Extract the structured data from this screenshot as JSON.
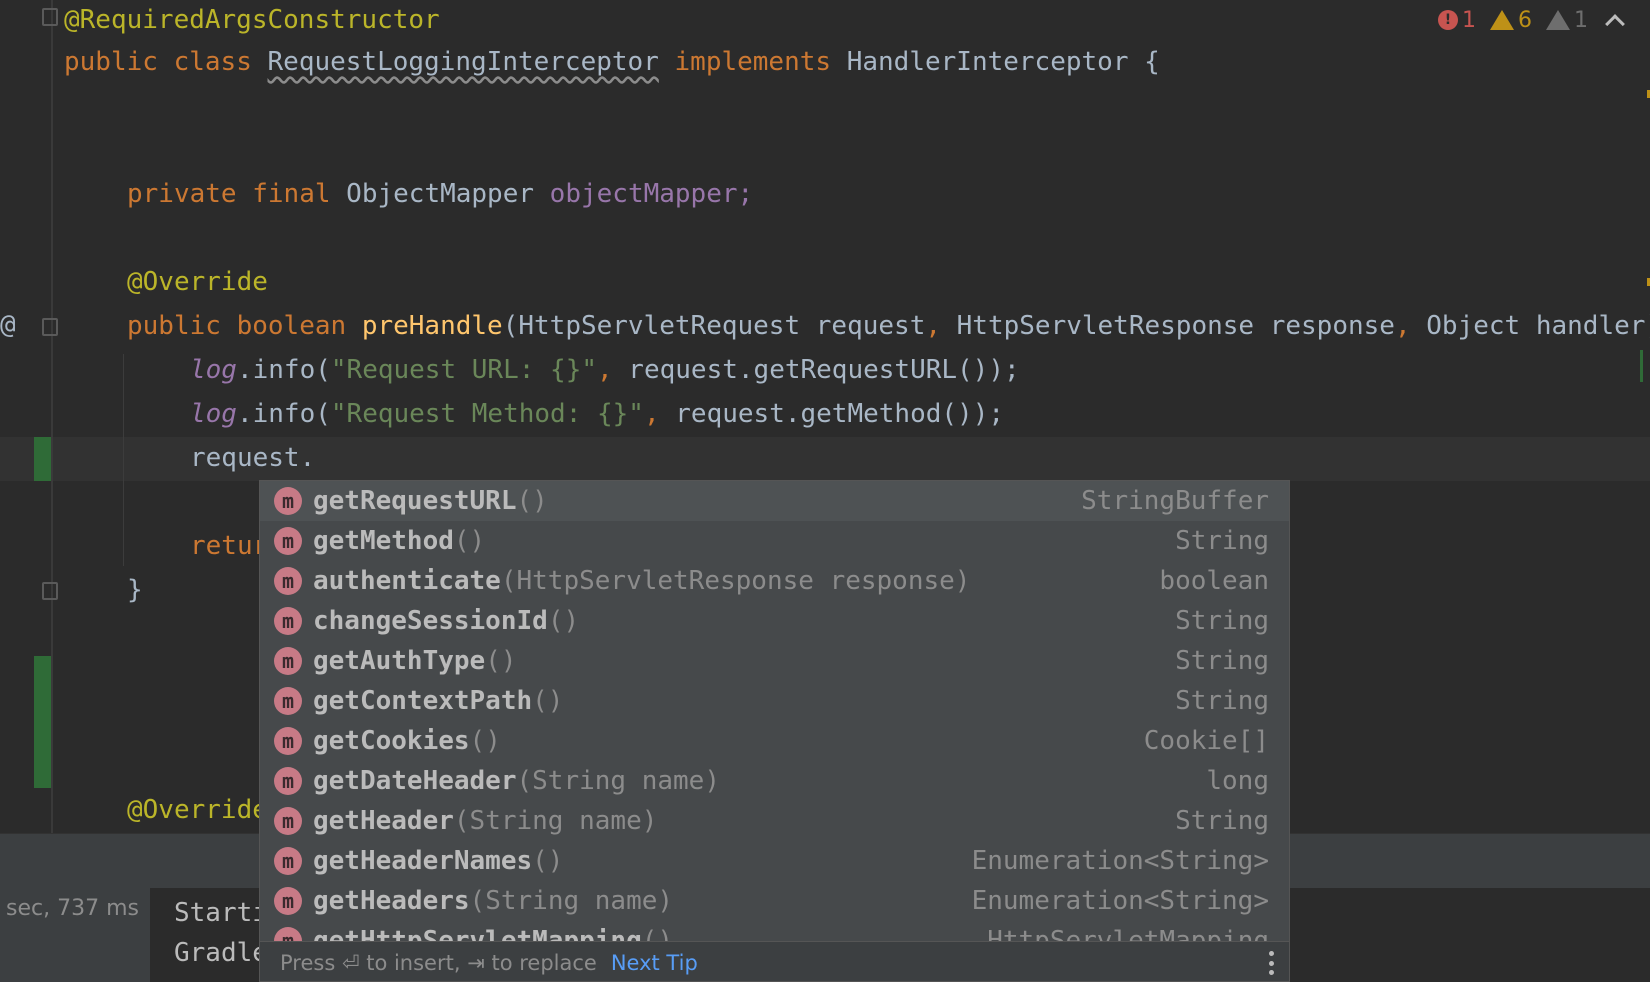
{
  "editor": {
    "lines": {
      "l1_ann": "@RequiredArgsConstructor",
      "l2_public": "public",
      "l2_class": "class",
      "l2_name": "RequestLoggingInterceptor",
      "l2_implements": "implements",
      "l2_iface": "HandlerInterceptor {",
      "l4_private": "private",
      "l4_final": "final",
      "l4_type": "ObjectMapper",
      "l4_field": "objectMapper;",
      "l6_ann": "@Override",
      "l7_public": "public",
      "l7_boolean": "boolean",
      "l7_method": "preHandle",
      "l7_sig_a": "(HttpServletRequest request",
      "l7_comma1": ",",
      "l7_sig_b": " HttpServletResponse response",
      "l7_comma2": ",",
      "l7_sig_c": " Object handler)",
      "l8_log": "log",
      "l8_call": ".info(",
      "l8_str": "\"Request URL: {}\"",
      "l8_comma": ",",
      "l8_rest": " request.getRequestURL());",
      "l9_log": "log",
      "l9_call": ".info(",
      "l9_str": "\"Request Method: {}\"",
      "l9_comma": ",",
      "l9_rest": " request.getMethod());",
      "l10": "request.",
      "l11_return": "retur",
      "l12_brace": "}",
      "l13_ann": "@Override"
    },
    "gutter_at": "@"
  },
  "inspections": {
    "errors": "1",
    "warnings": "6",
    "weak_warnings": "1"
  },
  "console": {
    "time": "sec, 737 ms",
    "line1": "Starti",
    "line2": "Gradle"
  },
  "completion": {
    "items": [
      {
        "name": "getRequestURL",
        "params": "()",
        "type": "StringBuffer",
        "icon": "m"
      },
      {
        "name": "getMethod",
        "params": "()",
        "type": "String",
        "icon": "m"
      },
      {
        "name": "authenticate",
        "params": "(HttpServletResponse response)",
        "type": "boolean",
        "icon": "m"
      },
      {
        "name": "changeSessionId",
        "params": "()",
        "type": "String",
        "icon": "m"
      },
      {
        "name": "getAuthType",
        "params": "()",
        "type": "String",
        "icon": "m"
      },
      {
        "name": "getContextPath",
        "params": "()",
        "type": "String",
        "icon": "m"
      },
      {
        "name": "getCookies",
        "params": "()",
        "type": "Cookie[]",
        "icon": "m"
      },
      {
        "name": "getDateHeader",
        "params": "(String name)",
        "type": "long",
        "icon": "m"
      },
      {
        "name": "getHeader",
        "params": "(String name)",
        "type": "String",
        "icon": "m"
      },
      {
        "name": "getHeaderNames",
        "params": "()",
        "type": "Enumeration<String>",
        "icon": "m"
      },
      {
        "name": "getHeaders",
        "params": "(String name)",
        "type": "Enumeration<String>",
        "icon": "m"
      },
      {
        "name": "getHttpServletMapping",
        "params": "()",
        "type": "HttpServletMapping",
        "icon": "m"
      }
    ],
    "footer": {
      "hint": "Press ⏎ to insert, ⇥ to replace",
      "tip": "Next Tip"
    }
  },
  "colors": {
    "keyword": "#cc7832",
    "annotation": "#bbb529",
    "field": "#9876aa",
    "string": "#6a8759",
    "method_decl": "#ffc66d",
    "method_icon": "#c77a86",
    "link": "#589df6"
  }
}
